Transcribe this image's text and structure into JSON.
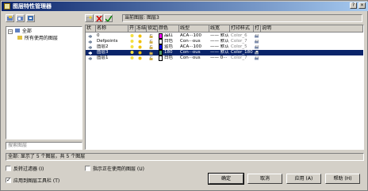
{
  "window": {
    "title": "图层特性管理器"
  },
  "titlebar_buttons": {
    "help": "?",
    "close": "×"
  },
  "toolbar": {
    "current_layer_label": "当前图层",
    "current_layer_value": "图层3"
  },
  "tree": {
    "root": "全部",
    "child": "所有使用的图层"
  },
  "search": {
    "placeholder": "搜索图层"
  },
  "columns": [
    "状",
    "名称",
    "开",
    "冻结",
    "锁定",
    "颜色",
    "线型",
    "线宽",
    "打印样式",
    "打",
    "说明"
  ],
  "layers": [
    {
      "name": "0",
      "color_name": "品红",
      "color": "#ff00ff",
      "linetype": "ACA···100",
      "lineweight": "—— 默认",
      "plot_style": "Color_6",
      "selected": false
    },
    {
      "name": "Defpoints",
      "color_name": "白色",
      "color": "#ffffff",
      "linetype": "Con···ous",
      "lineweight": "—— 默认",
      "plot_style": "Color_7",
      "selected": false
    },
    {
      "name": "图层2",
      "color_name": "蓝色",
      "color": "#0000ff",
      "linetype": "ACA···100",
      "lineweight": "—— 默认",
      "plot_style": "Color_5",
      "selected": false
    },
    {
      "name": "图层3",
      "color_name": "180",
      "color": "#4c9966",
      "linetype": "Con···ous",
      "lineweight": "—— 默认",
      "plot_style": "Color_180",
      "selected": true
    },
    {
      "name": "图层1",
      "color_name": "白色",
      "color": "#ffffff",
      "linetype": "Con···ous",
      "lineweight": "—— 0···",
      "plot_style": "Color_7",
      "selected": false
    }
  ],
  "status": {
    "text": "全部: 显示了 5 个图层，共 5 个图层"
  },
  "options": {
    "invert_filter": "反转过滤器 (I)",
    "show_used": "指示正在使用的图层 (U)",
    "apply_toolbar": "应用到图层工具栏 (T)"
  },
  "buttons": {
    "ok": "确定",
    "cancel": "取消",
    "apply": "应用 (A)",
    "help": "帮助 (H)"
  },
  "colors": {
    "titlebar": "#0a246a",
    "selection": "#0a246a"
  }
}
